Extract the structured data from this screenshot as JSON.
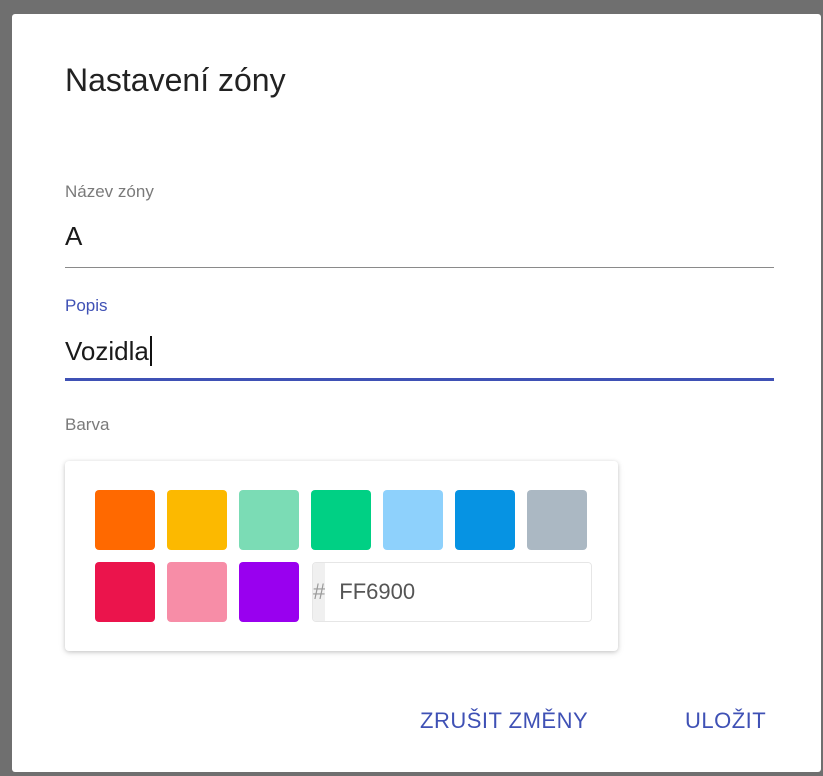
{
  "dialog": {
    "title": "Nastavení zóny"
  },
  "fields": {
    "name": {
      "label": "Název zóny",
      "value": "A"
    },
    "description": {
      "label": "Popis",
      "value": "Vozidla"
    },
    "color": {
      "label": "Barva"
    }
  },
  "palette": {
    "swatches": [
      "#FF6900",
      "#FCB900",
      "#7BDCB5",
      "#00D084",
      "#8ED1FC",
      "#0693E3",
      "#ABB8C3",
      "#EB144C",
      "#F78DA7",
      "#9900EF"
    ],
    "hex_prefix": "#",
    "hex_value": "FF6900"
  },
  "actions": {
    "cancel_label": "ZRUŠIT ZMĚNY",
    "save_label": "ULOŽIT"
  },
  "colors": {
    "accent": "#3F51B5",
    "backdrop": "#6F6F6F"
  }
}
